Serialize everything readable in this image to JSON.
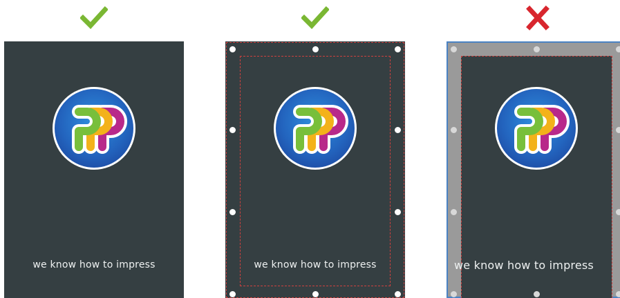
{
  "panels": [
    {
      "verdict": "correct",
      "check_icon": "check-icon",
      "check_color": "#7ab733",
      "tagline": "we know how to impress",
      "bleed_markers": false
    },
    {
      "verdict": "correct",
      "check_icon": "check-icon",
      "check_color": "#7ab733",
      "tagline": "we know how to impress",
      "bleed_markers": true
    },
    {
      "verdict": "incorrect",
      "check_icon": "cross-icon",
      "check_color": "#d8262e",
      "tagline": "we know how to impress",
      "bleed_markers": true
    }
  ],
  "colors": {
    "card_background": "#353f42",
    "bleed_border": "#d0413f",
    "wrong_frame": "#9a9a9a",
    "wrong_frame_outline": "#4a82c3"
  },
  "logo": {
    "icon": "ppp-logo-icon",
    "letter_colors": [
      "#78bf3b",
      "#f3b21a",
      "#b8298a"
    ]
  }
}
